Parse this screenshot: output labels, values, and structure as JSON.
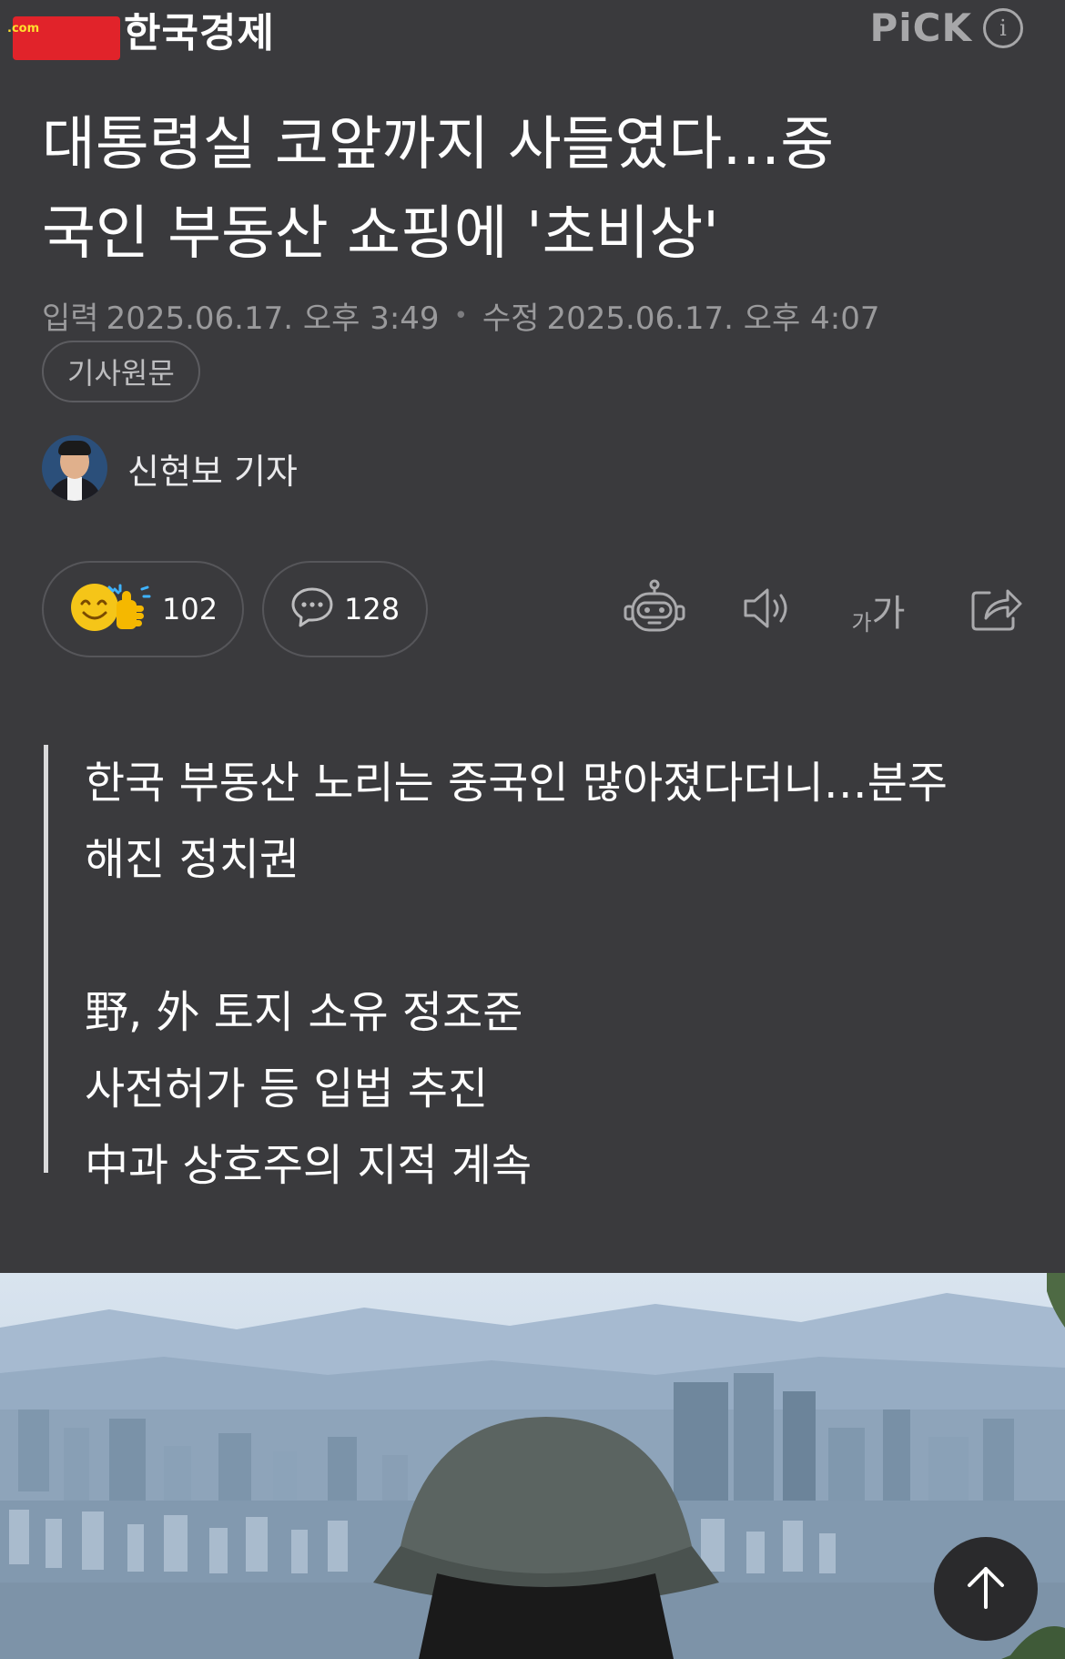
{
  "header": {
    "logo_badge": ".com",
    "logo_text": "한국경제",
    "pick_label": "PiCK",
    "info_label": "i"
  },
  "article": {
    "title": "대통령실 코앞까지 사들였다…중국인 부동산 쇼핑에 '초비상'",
    "title_line1": "대통령실 코앞까지 사들였다…중",
    "title_line2": "국인 부동산 쇼핑에 '초비상'",
    "published_label": "입력",
    "published": "2025.06.17. 오후 3:49",
    "modified_label": "수정",
    "modified": "2025.06.17. 오후 4:07",
    "source_button": "기사원문",
    "reporter": "신현보 기자"
  },
  "actions": {
    "like_count": "102",
    "comment_count": "128",
    "font_small": "가",
    "font_big": "가"
  },
  "summary": {
    "line1": "한국 부동산 노리는 중국인 많아졌다더니…분주",
    "line2": "해진 정치권",
    "line3": "野, 外 토지 소유 정조준",
    "line4": "사전허가 등 입법 추진",
    "line5": "中과 상호주의 지적 계속"
  },
  "colors": {
    "background": "#3a3a3d",
    "logo_red": "#e1232a",
    "muted_text": "#9a9a9c",
    "like_yellow": "#f5c518"
  },
  "icons": [
    "info-icon",
    "emoji-like-icon",
    "comment-bubble-icon",
    "robot-summary-icon",
    "speaker-icon",
    "font-size-icon",
    "share-icon",
    "arrow-up-icon"
  ]
}
